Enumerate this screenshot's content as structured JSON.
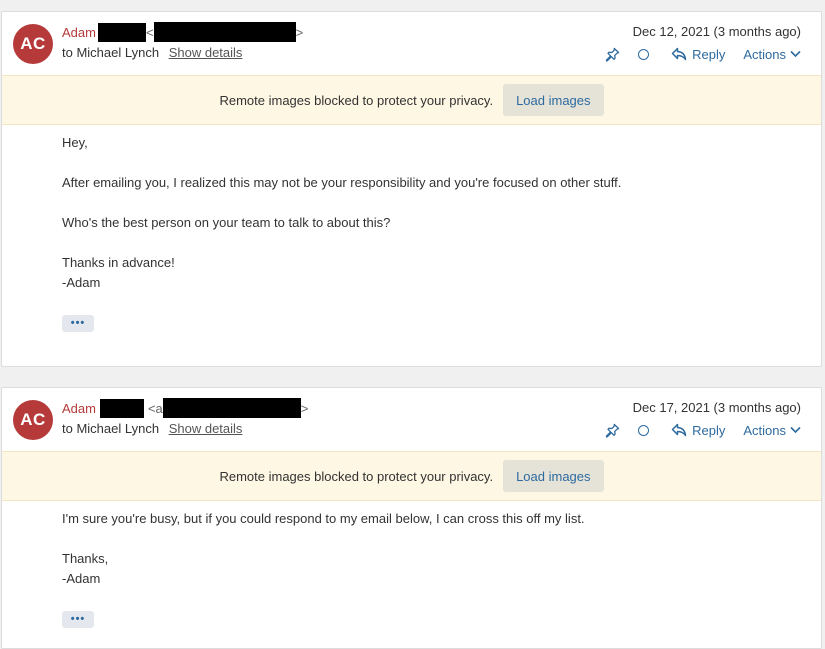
{
  "messages": [
    {
      "avatar_initials": "AC",
      "sender_first": "Adam",
      "email_open": "<",
      "email_close": ">",
      "to_text": "to Michael Lynch",
      "show_details": "Show details",
      "date": "Dec 12, 2021 (3 months ago)",
      "reply_label": "Reply",
      "actions_label": "Actions",
      "privacy_text": "Remote images blocked to protect your privacy.",
      "load_images": "Load images",
      "body_lines": [
        "Hey,",
        "",
        "After emailing you, I realized this may not be your responsibility and you're focused on other stuff.",
        "",
        "Who's the best person on your team to talk to about this?",
        "",
        "Thanks in advance!",
        "-Adam"
      ],
      "more_label": "•••"
    },
    {
      "avatar_initials": "AC",
      "sender_first": "Adam",
      "email_open": "<a",
      "email_close": ">",
      "to_text": "to Michael Lynch",
      "show_details": "Show details",
      "date": "Dec 17, 2021 (3 months ago)",
      "reply_label": "Reply",
      "actions_label": "Actions",
      "privacy_text": "Remote images blocked to protect your privacy.",
      "load_images": "Load images",
      "body_lines": [
        "I'm sure you're busy, but if you could respond to my email below, I can cross this off my list.",
        "",
        "Thanks,",
        "-Adam"
      ],
      "more_label": "•••"
    }
  ],
  "colors": {
    "accent": "#2d6a9f",
    "sender": "#b73a3a",
    "privacy_bg": "#fdf7e3"
  }
}
